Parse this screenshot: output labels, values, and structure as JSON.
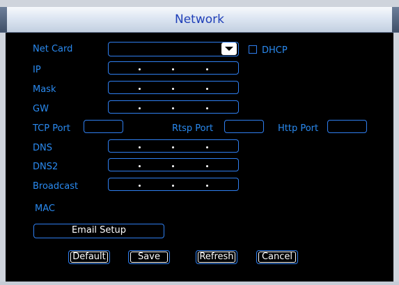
{
  "dialog": {
    "title": "Network"
  },
  "fields": {
    "net_card_label": "Net Card",
    "net_card_value": "",
    "dhcp_label": "DHCP",
    "dhcp_checked": false,
    "ip_label": "IP",
    "mask_label": "Mask",
    "gw_label": "GW",
    "tcp_port_label": "TCP Port",
    "tcp_port_value": "",
    "rtsp_port_label": "Rtsp Port",
    "rtsp_port_value": "",
    "http_port_label": "Http Port",
    "http_port_value": "",
    "dns_label": "DNS",
    "dns2_label": "DNS2",
    "broadcast_label": "Broadcast",
    "mac_label": "MAC",
    "mac_value": ""
  },
  "buttons": {
    "email_setup": "Email Setup",
    "default": "Default",
    "save": "Save",
    "refresh": "Refresh",
    "cancel": "Cancel"
  },
  "colors": {
    "label": "#2a8af0",
    "border": "#2f7ff0",
    "title": "#1f3fb8",
    "background": "#000000"
  },
  "icons": {
    "dropdown": "chevron-down-icon",
    "checkbox": "checkbox-icon"
  }
}
